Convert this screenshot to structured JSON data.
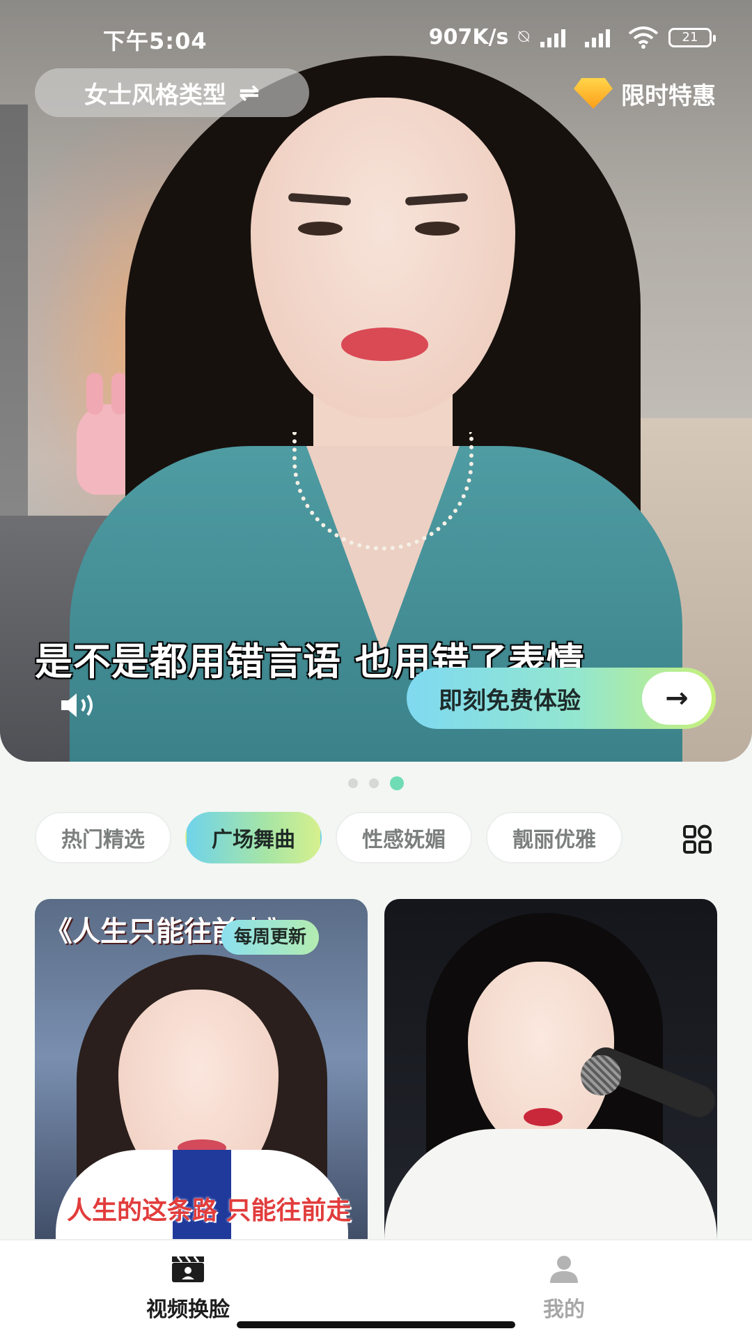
{
  "status_bar": {
    "time": "下午5:04",
    "network_speed": "907K/s",
    "battery": "21"
  },
  "header": {
    "style_selector_label": "女士风格类型",
    "promo_label": "限时特惠"
  },
  "hero": {
    "subtitle": "是不是都用错言语 也用错了表情",
    "cta_label": "即刻免费体验",
    "carousel_count": 3,
    "carousel_active_index": 2
  },
  "categories": {
    "tabs": [
      "热门精选",
      "广场舞曲",
      "性感妩媚",
      "靓丽优雅"
    ],
    "active_index": 1
  },
  "cards": [
    {
      "title": "《人生只能往前走》",
      "badge": "每周更新",
      "caption": "人生的这条路 只能往前走"
    },
    {
      "title": "",
      "badge": "",
      "caption": ""
    }
  ],
  "bottom_nav": {
    "items": [
      {
        "label": "视频换脸",
        "icon": "clapperboard-icon",
        "active": true
      },
      {
        "label": "我的",
        "icon": "user-icon",
        "active": false
      }
    ]
  },
  "colors": {
    "accent_gradient_start": "#6fd3ea",
    "accent_gradient_end": "#d6f08e",
    "active_dot": "#6fdcb6",
    "promo_gold": "#ffb020"
  }
}
